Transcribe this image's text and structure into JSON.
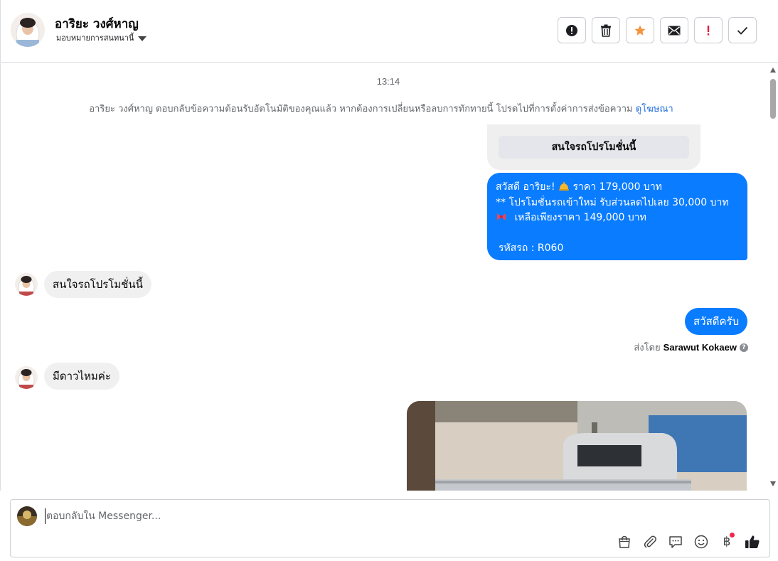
{
  "header": {
    "name": "อาริยะ วงศ์หาญ",
    "assign_label": "มอบหมายการสนทนานี้",
    "actions": [
      "spam",
      "delete",
      "star",
      "mark-unread",
      "follow-up",
      "done"
    ]
  },
  "chat": {
    "timestamp": "13:14",
    "system_message": "อาริยะ วงศ์หาญ ตอบกลับข้อความต้อนรับอัตโนมัติของคุณแล้ว หากต้องการเปลี่ยนหรือลบการทักทายนี้ โปรดไปที่การตั้งค่าการส่งข้อความ",
    "system_link": "ดูโฆษณา",
    "card_button": "สนใจรถโปรโมชั่นนี้",
    "promo": {
      "line1_a": "สวัสดี อาริยะ!",
      "line1_b": "ราคา 179,000 บาท",
      "line2": "** โปรโมชั่นรถเข้าใหม่ รับส่วนลดไปเลย 30,000 บาท",
      "line3": "เหลือเพียงราคา 149,000 บาท",
      "line4": "รหัสรถ : R060"
    },
    "incoming_1": "สนใจรถโปรโมชั่นนี้",
    "outgoing_greeting": "สวัสดีครับ",
    "sent_by_label": "ส่งโดย",
    "sent_by_name": "Sarawut Kokaew",
    "incoming_2": "มีดาวไหมค่ะ"
  },
  "composer": {
    "placeholder": "ตอบกลับใน Messenger...",
    "tools": [
      "shopping-bag",
      "attachment",
      "saved-replies",
      "emoji",
      "baht-payment",
      "like"
    ],
    "baht_symbol": "฿"
  },
  "colors": {
    "accent_blue": "#0a7cff",
    "incoming_bubble": "#f0f0f0",
    "star_orange": "#f5933f",
    "follow_up_red": "#e41e3f",
    "link_blue": "#216fdb"
  }
}
